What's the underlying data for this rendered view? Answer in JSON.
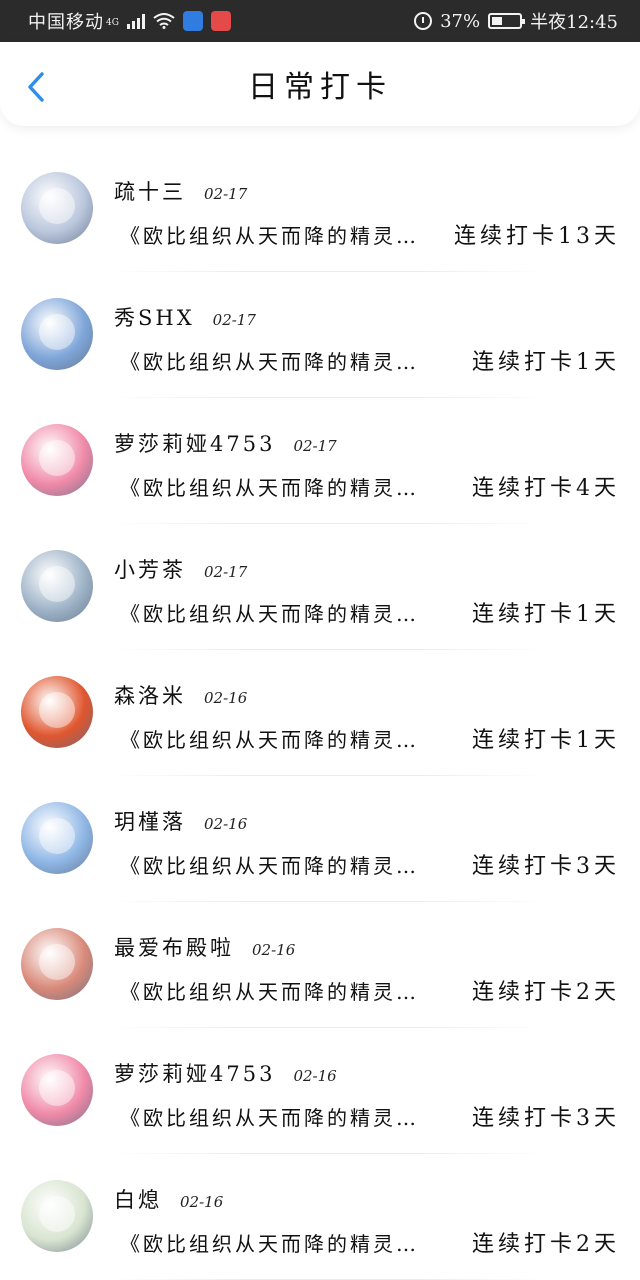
{
  "status_bar": {
    "carrier": "中国移动",
    "network": "4G",
    "battery": "37%",
    "battery_level": 0.37,
    "time": "半夜12:45",
    "app_icons": [
      "baidu-app-icon",
      "huawei-app-icon"
    ]
  },
  "header": {
    "back_icon": "chevron-left-icon",
    "title": "日常打卡",
    "accent_color": "#2f8fe8"
  },
  "checkins": [
    {
      "name": "疏十三",
      "date": "02-17",
      "book": "《欧比组织从天而降的精灵…",
      "streak": "连续打卡13天",
      "avatar_color": "#b9c6dc"
    },
    {
      "name": "秀SHX",
      "date": "02-17",
      "book": "《欧比组织从天而降的精灵…",
      "streak": "连续打卡1天",
      "avatar_color": "#7fa6d9"
    },
    {
      "name": "萝莎莉娅4753",
      "date": "02-17",
      "book": "《欧比组织从天而降的精灵…",
      "streak": "连续打卡4天",
      "avatar_color": "#f08aa8"
    },
    {
      "name": "小芳茶",
      "date": "02-17",
      "book": "《欧比组织从天而降的精灵…",
      "streak": "连续打卡1天",
      "avatar_color": "#9fb4c8"
    },
    {
      "name": "森洛米",
      "date": "02-16",
      "book": "《欧比组织从天而降的精灵…",
      "streak": "连续打卡1天",
      "avatar_color": "#e0562f"
    },
    {
      "name": "玥槿落",
      "date": "02-16",
      "book": "《欧比组织从天而降的精灵…",
      "streak": "连续打卡3天",
      "avatar_color": "#8fb7e6"
    },
    {
      "name": "最爱布殿啦",
      "date": "02-16",
      "book": "《欧比组织从天而降的精灵…",
      "streak": "连续打卡2天",
      "avatar_color": "#d98a7a"
    },
    {
      "name": "萝莎莉娅4753",
      "date": "02-16",
      "book": "《欧比组织从天而降的精灵…",
      "streak": "连续打卡3天",
      "avatar_color": "#f08aa8"
    },
    {
      "name": "白熄",
      "date": "02-16",
      "book": "《欧比组织从天而降的精灵…",
      "streak": "连续打卡2天",
      "avatar_color": "#d8e4d0"
    }
  ]
}
